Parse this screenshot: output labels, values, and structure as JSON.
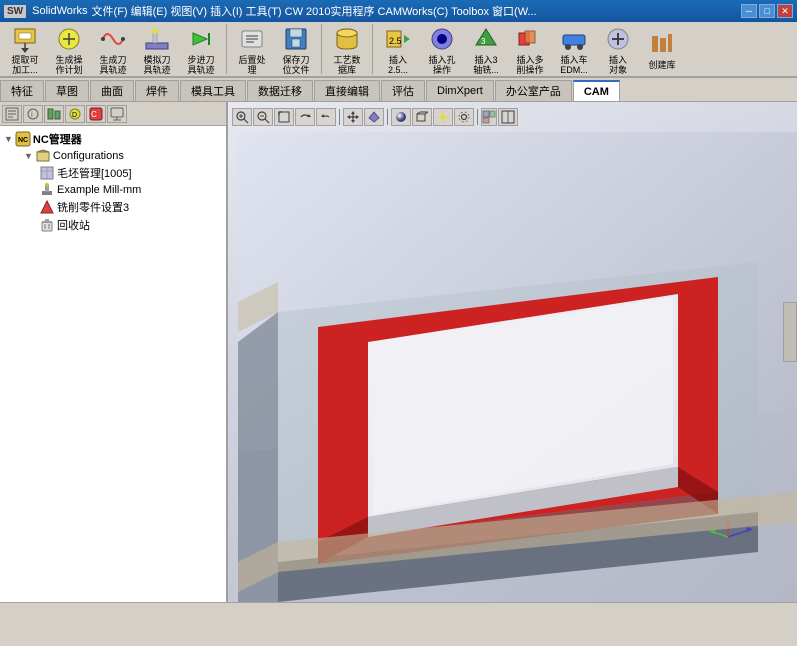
{
  "titlebar": {
    "logo": "SW",
    "title": "SolidWorks",
    "subtitle": "文件(F)  编辑(E)  视图(V)  插入(I)  工具(T)  CW 2010实用程序  CAMWorks(C)  Toolbox  窗口(W..."
  },
  "menubar": {
    "items": [
      "文件(F)",
      "编辑(E)",
      "视图(V)",
      "插入(I)",
      "工具(T)",
      "CW 2010 实用程序",
      "CAMWorks(C)",
      "Toolbox",
      "窗口(W..."
    ]
  },
  "toolbar": {
    "groups": [
      {
        "icon": "⬆",
        "label": "提取可\n加工..."
      },
      {
        "icon": "🔧",
        "label": "生成操\n作计划"
      },
      {
        "icon": "✂",
        "label": "生成刀\n具轨迹"
      },
      {
        "icon": "🔪",
        "label": "模拟刀\n具轨迹"
      },
      {
        "icon": "➡",
        "label": "步进刀\n具轨迹"
      },
      {
        "icon": "📋",
        "label": "后置处\n理"
      },
      {
        "icon": "💾",
        "label": "保存刀\n位文件"
      },
      {
        "icon": "🔢",
        "label": "工艺数\n据库"
      },
      {
        "icon": "📥",
        "label": "插入\n2.5..."
      },
      {
        "icon": "🔵",
        "label": "插入孔\n操作"
      },
      {
        "icon": "3️⃣",
        "label": "插入3\n轴铣..."
      },
      {
        "icon": "📊",
        "label": "插入多\n削操作"
      },
      {
        "icon": "🚗",
        "label": "插入车\nEDM..."
      },
      {
        "icon": "📌",
        "label": "插入\n对象"
      },
      {
        "icon": "🏗",
        "label": "创建库"
      }
    ]
  },
  "tabs": {
    "items": [
      "特征",
      "草图",
      "曲面",
      "焊件",
      "模具工具",
      "数据迁移",
      "直接编辑",
      "评估",
      "DimXpert",
      "办公室产品",
      "CAM"
    ],
    "active": "CAM"
  },
  "panel": {
    "toolbar_icons": [
      "🔲",
      "📋",
      "🔧",
      "⭐",
      "📌",
      "📊"
    ],
    "tree": {
      "root": "NC管理器",
      "nodes": [
        {
          "type": "folder",
          "label": "Configurations",
          "indent": 1,
          "expanded": true
        },
        {
          "type": "item",
          "label": "毛坯管理[1005]",
          "indent": 2,
          "icon": "📦"
        },
        {
          "type": "item",
          "label": "Example Mill-mm",
          "indent": 2,
          "icon": "⚙"
        },
        {
          "type": "item",
          "label": "铣削零件设置3",
          "indent": 2,
          "icon": "🔴"
        },
        {
          "type": "item",
          "label": "回收站",
          "indent": 2,
          "icon": "🗑"
        }
      ]
    }
  },
  "viewport": {
    "toolbar_icons": [
      "🔍+",
      "🔍-",
      "⬜",
      "🔄",
      "↩",
      "↕",
      "↔",
      "⚙",
      "🎨",
      "💡",
      "🔆",
      "⚙2",
      "📐",
      "📏",
      "⬜2"
    ],
    "model": {
      "background_colors": [
        "#e8e8f0",
        "#d0d4e0",
        "#b8bcc8"
      ],
      "platform_color": "#c8ccd8",
      "red_pocket_color": "#cc2222",
      "white_top_color": "#f0f0f0",
      "dark_side_color": "#606878"
    }
  },
  "statusbar": {
    "text": ""
  }
}
